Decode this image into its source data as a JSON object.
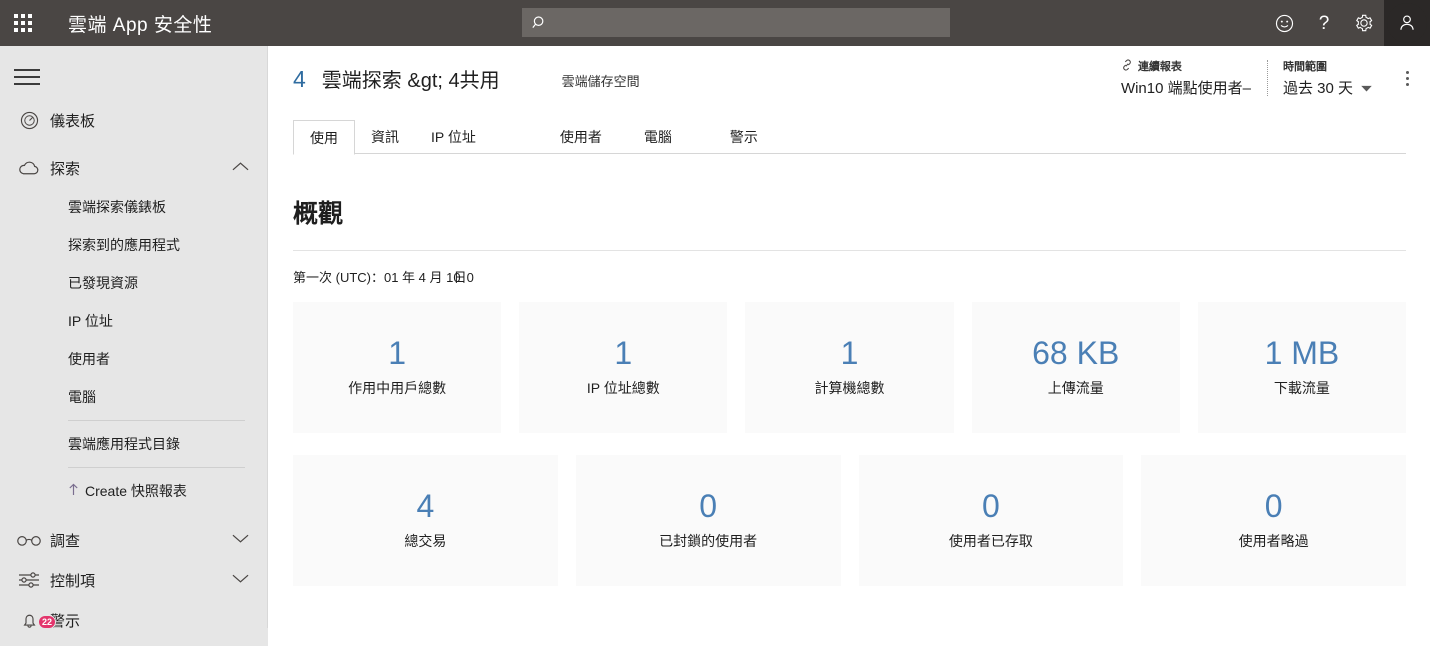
{
  "topbar": {
    "app_launcher": "waffle-icon",
    "brand": "雲端 App 安全性",
    "search": {
      "value": "",
      "placeholder": ""
    },
    "icons": [
      {
        "name": "feedback-smiley-icon",
        "glyph": "☺"
      },
      {
        "name": "help-question-icon",
        "glyph": "?"
      },
      {
        "name": "settings-gear-icon",
        "glyph": "⚙"
      },
      {
        "name": "account-avatar-icon",
        "glyph": "person"
      }
    ]
  },
  "sidebar": {
    "menu_toggle": "hamburger-icon",
    "dashboard": {
      "label": "儀表板",
      "icon": "gauge-icon"
    },
    "discover": {
      "label": "探索",
      "icon": "cloud-icon",
      "expanded": true
    },
    "discover_items": [
      {
        "label": "雲端探索儀錶板"
      },
      {
        "label": "探索到的應用程式"
      },
      {
        "label": "已發現資源"
      },
      {
        "label": "IP 位址"
      },
      {
        "label": "使用者"
      },
      {
        "label": "電腦"
      }
    ],
    "catalog": {
      "label": "雲端應用程式目錄"
    },
    "create_report": {
      "label": "Create 快照報表",
      "icon": "upload-arrow-icon"
    },
    "investigate": {
      "label": "調查",
      "icon": "glasses-icon"
    },
    "control": {
      "label": "控制項",
      "icon": "sliders-icon"
    },
    "alerts": {
      "label": "警示",
      "icon": "bell-icon",
      "badge": "22"
    }
  },
  "page": {
    "breadcrumb_number": "4",
    "breadcrumb_title": "雲端探索 &gt; 4共用",
    "subtitle": "雲端儲存空間",
    "continuous_report": {
      "label": "連續報表",
      "value": "Win10 端點使用者–",
      "icon": "link-icon"
    },
    "time_range": {
      "label": "時間範圍",
      "value": "過去 30 天",
      "icon": "chevron-down-icon"
    },
    "more_menu": "kebab-menu-icon",
    "tabs": [
      {
        "label": "使用",
        "active": true
      },
      {
        "label": "資訊",
        "active": false
      },
      {
        "label": "IP 位址",
        "active": false
      },
      {
        "label": "使用者",
        "active": false
      },
      {
        "label": "電腦",
        "active": false
      },
      {
        "label": "警示",
        "active": false
      }
    ]
  },
  "overview": {
    "title": "概觀",
    "first_seen": "第一次 (UTC)：01 年 4 月 10",
    "first_seen_overlap": "日0",
    "cards_row1": [
      {
        "value": "1",
        "label": "作用中用戶總數"
      },
      {
        "value": "1",
        "label": "IP 位址總數"
      },
      {
        "value": "1",
        "label": "計算機總數"
      },
      {
        "value": "68 KB",
        "label": "上傳流量"
      },
      {
        "value": "1 MB",
        "label": "下載流量"
      }
    ],
    "cards_row2": [
      {
        "value": "4",
        "label": "總交易"
      },
      {
        "value": "0",
        "label": "已封鎖的使用者"
      },
      {
        "value": "0",
        "label": "使用者已存取"
      },
      {
        "value": "0",
        "label": "使用者略過"
      }
    ]
  },
  "colors": {
    "topbar_bg": "#4a4644",
    "sidebar_bg": "#e6e6e6",
    "accent_blue": "#4a7fb5",
    "breadcrumb_blue": "#2f6ca0",
    "badge_pink": "#e3356c",
    "card_bg": "#fafafa"
  }
}
